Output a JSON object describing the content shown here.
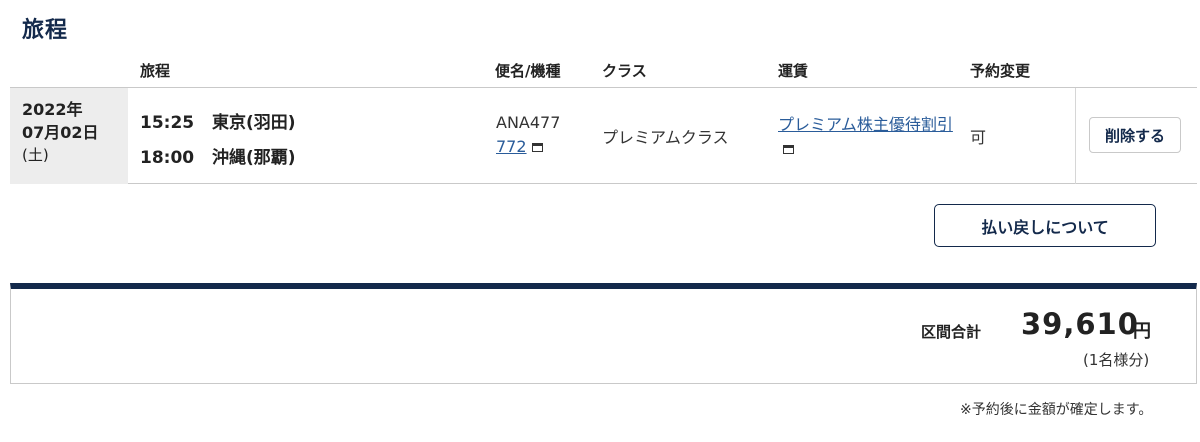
{
  "section": {
    "title": "旅程"
  },
  "headers": {
    "itinerary": "旅程",
    "flight": "便名/機種",
    "class": "クラス",
    "fare": "運賃",
    "change": "予約変更"
  },
  "row": {
    "date_year": "2022年",
    "date_md": "07月02日",
    "date_dow": "(土)",
    "depart_time": "15:25",
    "depart_place": "東京(羽田)",
    "arrive_time": "18:00",
    "arrive_place": "沖縄(那覇)",
    "flight_no": "ANA477",
    "aircraft": "772",
    "class_name": "プレミアムクラス",
    "fare_name": "プレミアム株主優待割引",
    "change": "可",
    "delete_label": "削除する"
  },
  "refund": {
    "label": "払い戻しについて"
  },
  "total": {
    "label": "区間合計",
    "amount": "39,610",
    "unit": "円",
    "pax": "(1名様分)"
  },
  "footnote": "※予約後に金額が確定します。",
  "colors": {
    "navy": "#13294b",
    "link": "#2a5c9a",
    "date_bg": "#ededed"
  }
}
